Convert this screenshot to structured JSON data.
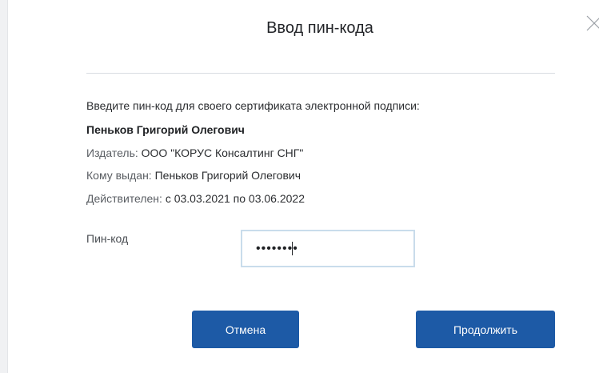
{
  "dialog": {
    "title": "Ввод пин-кода",
    "close_icon": "close-icon"
  },
  "certificate": {
    "prompt": "Введите пин-код для своего сертификата электронной подписи:",
    "owner_name": "Пеньков Григорий Олегович",
    "issuer_label": "Издатель:",
    "issuer_value": "ООО \"КОРУС Консалтинг СНГ\"",
    "issued_to_label": "Кому выдан:",
    "issued_to_value": "Пеньков Григорий Олегович",
    "valid_label": "Действителен:",
    "valid_value": "с 03.03.2021 по 03.06.2022"
  },
  "pin": {
    "label": "Пин-код",
    "value": "••••••••"
  },
  "buttons": {
    "cancel_label": "Отмена",
    "continue_label": "Продолжить"
  },
  "colors": {
    "button_bg": "#1d5aa6",
    "input_border": "#c9dceb",
    "divider": "#d9dde2"
  }
}
